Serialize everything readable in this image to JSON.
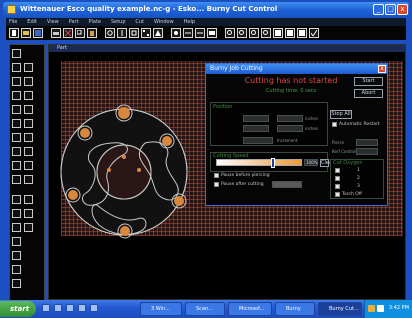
{
  "window": {
    "title": "Wittenauer   Esco  quality  example.nc-g  -  Esko...  Burny Cut Control",
    "minimize": "_",
    "maximize": "□",
    "close": "x"
  },
  "menu": [
    "File",
    "Edit",
    "View",
    "Part",
    "Plate",
    "Setup",
    "Cut",
    "Window",
    "Help"
  ],
  "drawing": {
    "title": "Part"
  },
  "dialog": {
    "title": "Burny Job Cutting",
    "close": "x",
    "status": "Cutting has not started",
    "substatus": "Cutting time: 0 secs",
    "buttons": {
      "start": "Start",
      "abort": "Abort",
      "stop_all": "Stop All",
      "clear": "Clear"
    },
    "position_label": "Position",
    "inches_1": "inches",
    "inches_2": "inches",
    "increment_label": "Increment",
    "automatic_restart": "Automatic Restart",
    "pierce_label": "Pierce",
    "kerf_label": "Kerf Control",
    "cut_oxygen_label": "Cut Oxygen",
    "pause_pierce": "Pause before piercing",
    "pause_cutting": "Pause after cutting",
    "cutting_speed_label": "Cutting Speed",
    "speed_value": "100%",
    "speed_fraction": 0.68,
    "torch_rows": [
      "1",
      "2",
      "3"
    ],
    "torch_off": "Torch Off"
  },
  "taskbar": {
    "start": "start",
    "tasks": [
      "3 Win...",
      "Scan... ",
      "Microsof...",
      "Burny",
      "Burny Cut..."
    ],
    "clock": "3:42 PM"
  }
}
